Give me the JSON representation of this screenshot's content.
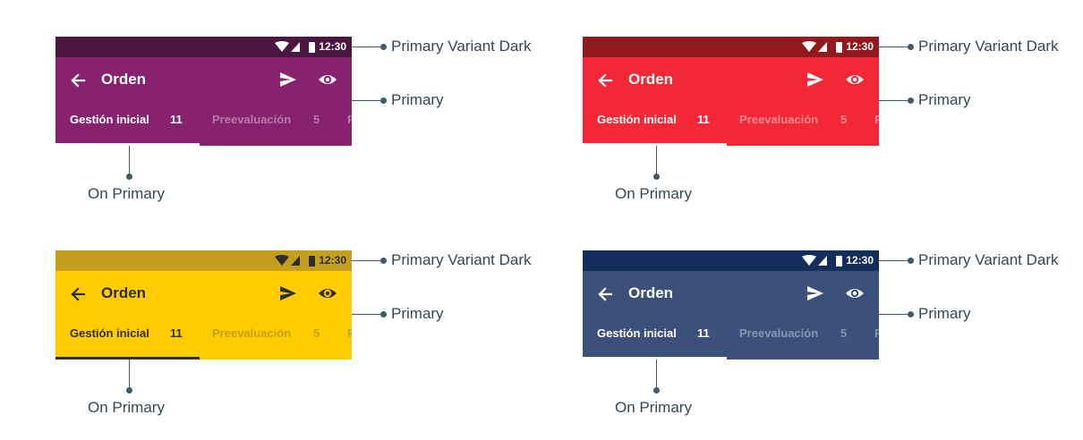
{
  "common": {
    "time": "12:30",
    "title": "Orden",
    "tab_active_label": "Gestión inicial",
    "tab_active_count": "11",
    "tab_next_label": "Preevaluación",
    "tab_next_count": "5",
    "tab_cut_label": "P",
    "callout_variant_dark": "Primary Variant Dark",
    "callout_primary": "Primary",
    "callout_on_primary": "On Primary"
  },
  "variants": [
    {
      "name": "purple",
      "status_bar_color": "#4a1540",
      "primary_color": "#86226f",
      "on_primary_color": "#ffffff",
      "next_tab_text_color": "#b77aab"
    },
    {
      "name": "red",
      "status_bar_color": "#94191f",
      "primary_color": "#f32735",
      "on_primary_color": "#ffffff",
      "next_tab_text_color": "#f98a92"
    },
    {
      "name": "yellow",
      "status_bar_color": "#c49f1c",
      "primary_color": "#ffcc00",
      "on_primary_color": "#2d2d2d",
      "next_tab_text_color": "#c69f16"
    },
    {
      "name": "navy",
      "status_bar_color": "#132e5c",
      "primary_color": "#3c5179",
      "on_primary_color": "#ffffff",
      "next_tab_text_color": "#8795b0"
    }
  ],
  "icons": [
    "back-arrow-icon",
    "send-icon",
    "eye-icon",
    "wifi-icon",
    "signal-icon",
    "battery-icon"
  ]
}
